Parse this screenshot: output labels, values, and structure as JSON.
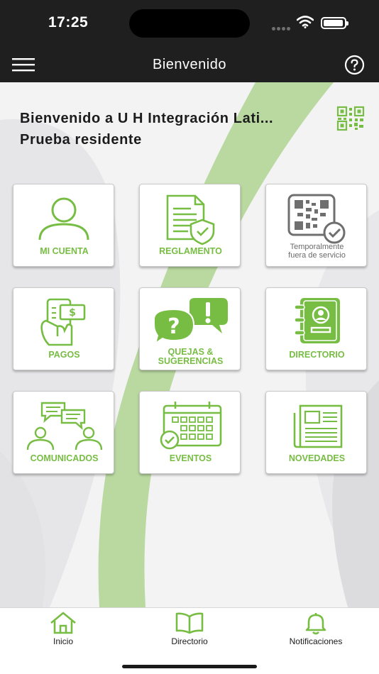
{
  "status": {
    "time": "17:25"
  },
  "nav": {
    "title": "Bienvenido"
  },
  "welcome": {
    "line1": "Bienvenido a U H Integración Lati...",
    "line2": "Prueba residente"
  },
  "tiles": {
    "mi_cuenta": "MI CUENTA",
    "reglamento": "REGLAMENTO",
    "qr_line1": "Temporalmente",
    "qr_line2": "fuera de servicio",
    "pagos": "PAGOS",
    "quejas_line1": "QUEJAS &",
    "quejas_line2": "SUGERENCIAS",
    "directorio": "DIRECTORIO",
    "comunicados": "COMUNICADOS",
    "eventos": "EVENTOS",
    "novedades": "NOVEDADES"
  },
  "tabs": {
    "inicio": "Inicio",
    "directorio": "Directorio",
    "notificaciones": "Notificaciones"
  },
  "colors": {
    "accent": "#77bd43",
    "bar": "#1f1f1f",
    "disabled": "#6b6b6b"
  }
}
